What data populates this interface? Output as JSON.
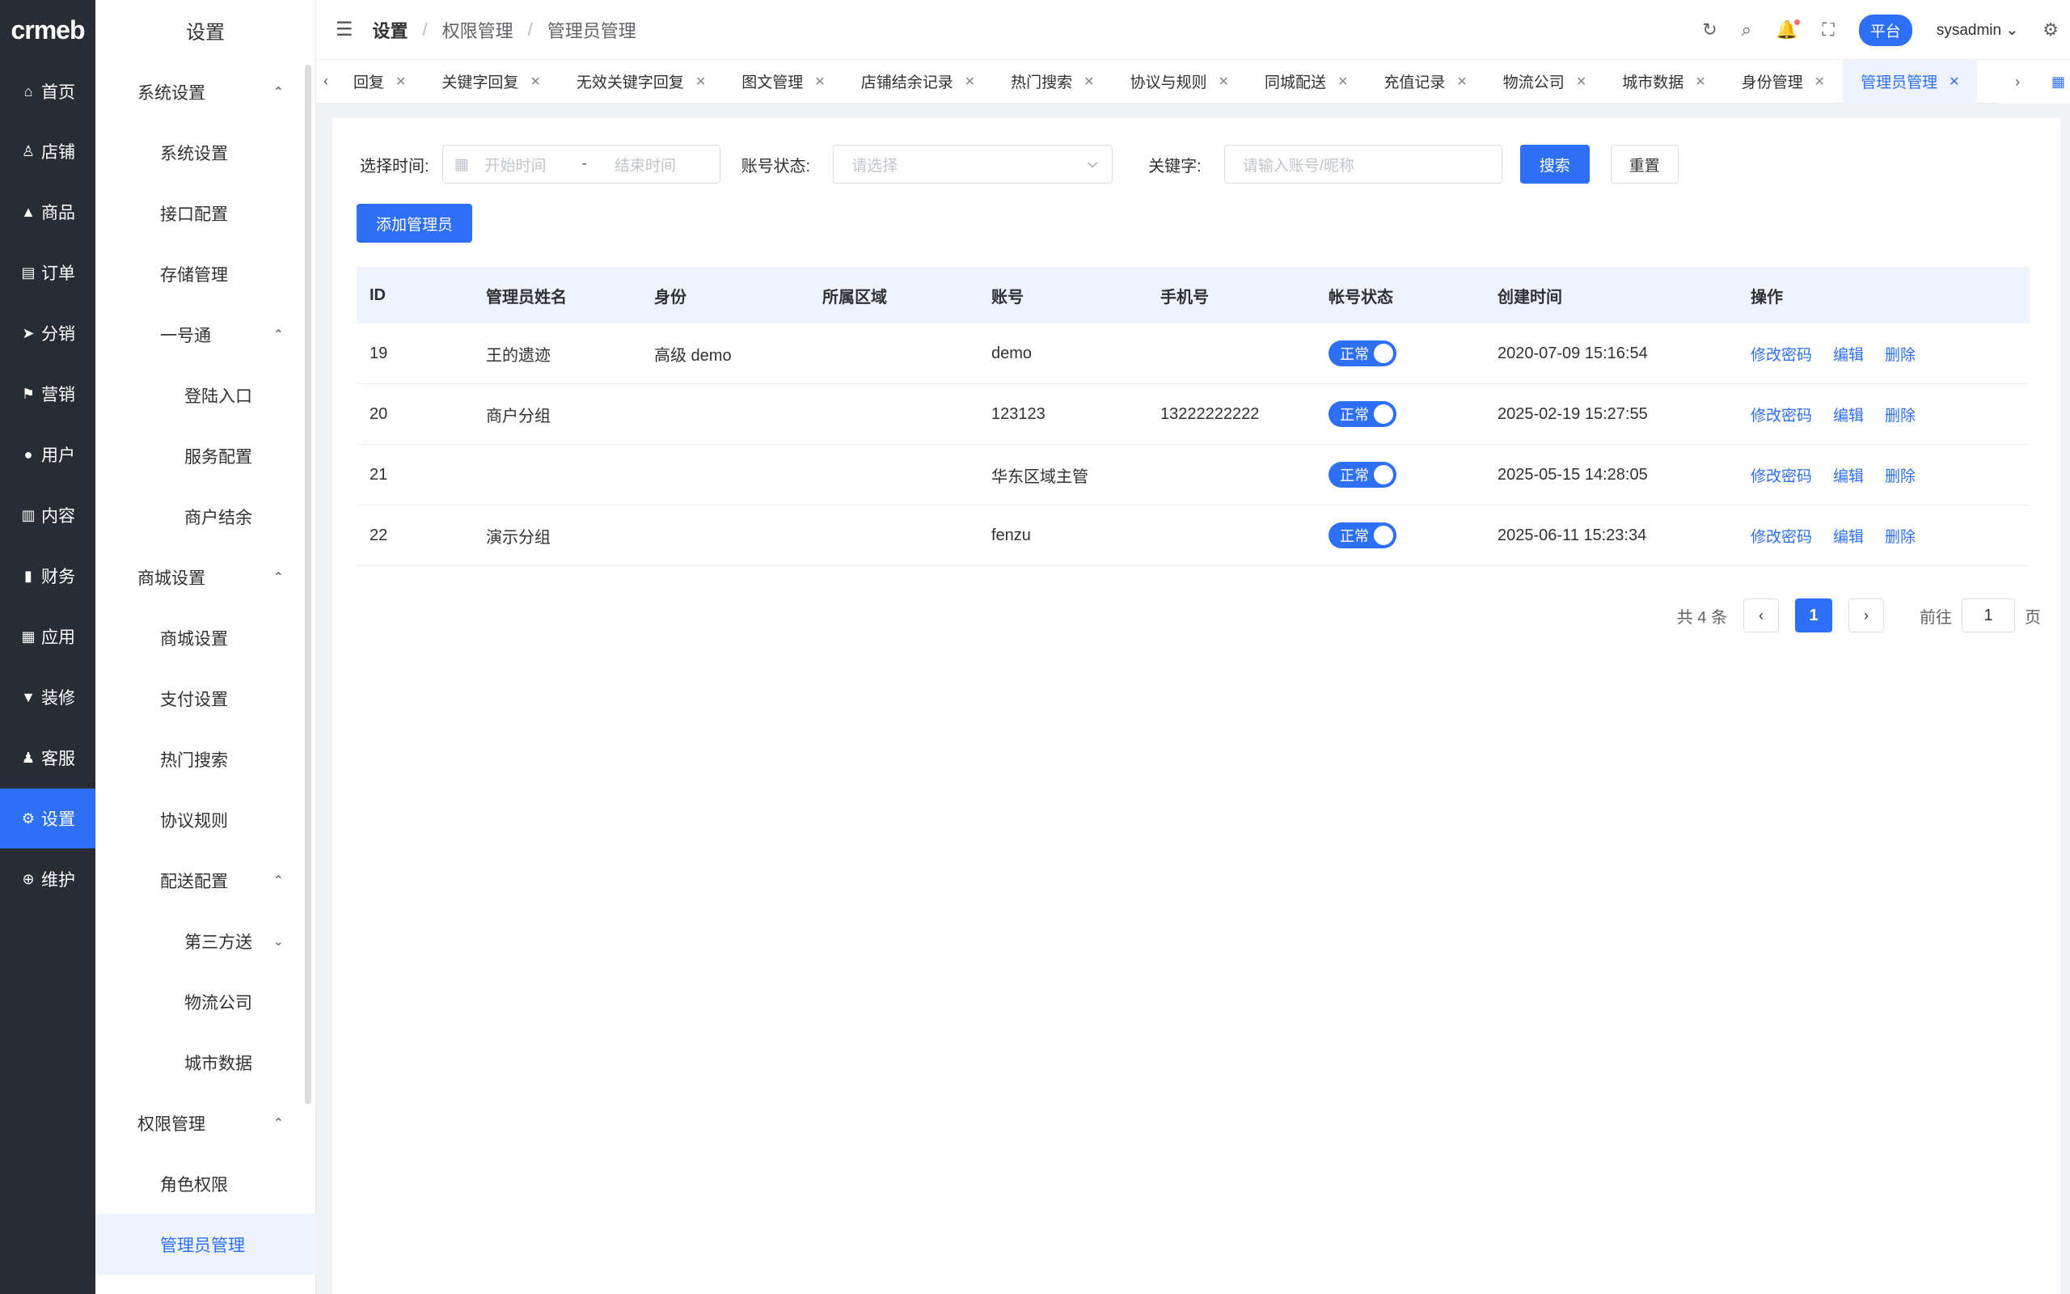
{
  "app": {
    "logo": "crmeb"
  },
  "rail": {
    "items": [
      {
        "label": "首页",
        "icon": "home-icon",
        "glyph": "⌂"
      },
      {
        "label": "店铺",
        "icon": "store-icon",
        "glyph": "♙"
      },
      {
        "label": "商品",
        "icon": "goods-icon",
        "glyph": "▲"
      },
      {
        "label": "订单",
        "icon": "order-icon",
        "glyph": "▤"
      },
      {
        "label": "分销",
        "icon": "distribution-icon",
        "glyph": "➤"
      },
      {
        "label": "营销",
        "icon": "marketing-icon",
        "glyph": "⚑"
      },
      {
        "label": "用户",
        "icon": "user-icon",
        "glyph": "●"
      },
      {
        "label": "内容",
        "icon": "content-icon",
        "glyph": "▥"
      },
      {
        "label": "财务",
        "icon": "finance-icon",
        "glyph": "▮"
      },
      {
        "label": "应用",
        "icon": "apps-icon",
        "glyph": "▦"
      },
      {
        "label": "装修",
        "icon": "decoration-icon",
        "glyph": "▼"
      },
      {
        "label": "客服",
        "icon": "service-icon",
        "glyph": "♟"
      },
      {
        "label": "设置",
        "icon": "settings-icon",
        "glyph": "⚙"
      },
      {
        "label": "维护",
        "icon": "maintenance-icon",
        "glyph": "⊕"
      }
    ],
    "active_index": 12
  },
  "submenu": {
    "title": "设置",
    "items": [
      {
        "label": "系统设置",
        "level": "group",
        "chev": "up"
      },
      {
        "label": "系统设置",
        "level": "lvl2"
      },
      {
        "label": "接口配置",
        "level": "lvl2"
      },
      {
        "label": "存储管理",
        "level": "lvl2"
      },
      {
        "label": "一号通",
        "level": "lvl2",
        "chev": "up"
      },
      {
        "label": "登陆入口",
        "level": "lvl3"
      },
      {
        "label": "服务配置",
        "level": "lvl3"
      },
      {
        "label": "商户结余",
        "level": "lvl3"
      },
      {
        "label": "商城设置",
        "level": "group",
        "chev": "up"
      },
      {
        "label": "商城设置",
        "level": "lvl2"
      },
      {
        "label": "支付设置",
        "level": "lvl2"
      },
      {
        "label": "热门搜索",
        "level": "lvl2"
      },
      {
        "label": "协议规则",
        "level": "lvl2"
      },
      {
        "label": "配送配置",
        "level": "lvl2",
        "chev": "up"
      },
      {
        "label": "第三方送",
        "level": "lvl3",
        "chev": "down"
      },
      {
        "label": "物流公司",
        "level": "lvl3"
      },
      {
        "label": "城市数据",
        "level": "lvl3"
      },
      {
        "label": "权限管理",
        "level": "group",
        "chev": "up"
      },
      {
        "label": "角色权限",
        "level": "lvl2"
      },
      {
        "label": "管理员管理",
        "level": "lvl2",
        "active": true
      }
    ]
  },
  "header": {
    "breadcrumb": [
      "设置",
      "权限管理",
      "管理员管理"
    ],
    "platform_label": "平台",
    "username": "sysadmin"
  },
  "tabs": [
    {
      "label": "回复"
    },
    {
      "label": "关键字回复"
    },
    {
      "label": "无效关键字回复"
    },
    {
      "label": "图文管理"
    },
    {
      "label": "店铺结余记录"
    },
    {
      "label": "热门搜索"
    },
    {
      "label": "协议与规则"
    },
    {
      "label": "同城配送"
    },
    {
      "label": "充值记录"
    },
    {
      "label": "物流公司"
    },
    {
      "label": "城市数据"
    },
    {
      "label": "身份管理"
    },
    {
      "label": "管理员管理",
      "active": true
    }
  ],
  "filters": {
    "time_label": "选择时间:",
    "start_placeholder": "开始时间",
    "range_sep": "-",
    "end_placeholder": "结束时间",
    "status_label": "账号状态:",
    "status_placeholder": "请选择",
    "keyword_label": "关键字:",
    "keyword_placeholder": "请输入账号/昵称",
    "search_button": "搜索",
    "reset_button": "重置"
  },
  "add_button": "添加管理员",
  "table": {
    "columns": [
      "ID",
      "管理员姓名",
      "身份",
      "所属区域",
      "账号",
      "手机号",
      "帐号状态",
      "创建时间",
      "操作"
    ],
    "rows": [
      {
        "id": "19",
        "name": "王的遗迹",
        "role": "高级 demo",
        "area": "",
        "account": "demo",
        "phone": "",
        "status": "正常",
        "created": "2020-07-09 15:16:54"
      },
      {
        "id": "20",
        "name": "商户分组",
        "role": "",
        "area": "",
        "account": "123123",
        "phone": "13222222222",
        "status": "正常",
        "created": "2025-02-19 15:27:55"
      },
      {
        "id": "21",
        "name": "",
        "role": "",
        "area": "",
        "account": "华东区域主管",
        "phone": "",
        "status": "正常",
        "created": "2025-05-15 14:28:05"
      },
      {
        "id": "22",
        "name": "演示分组",
        "role": "",
        "area": "",
        "account": "fenzu",
        "phone": "",
        "status": "正常",
        "created": "2025-06-11 15:23:34"
      }
    ],
    "actions": [
      "修改密码",
      "编辑",
      "删除"
    ]
  },
  "pagination": {
    "total_text": "共 4 条",
    "current_page": "1",
    "goto_label": "前往",
    "goto_value": "1",
    "page_suffix": "页"
  },
  "colors": {
    "primary": "#2d6ff7",
    "rail_bg": "#282c34"
  }
}
